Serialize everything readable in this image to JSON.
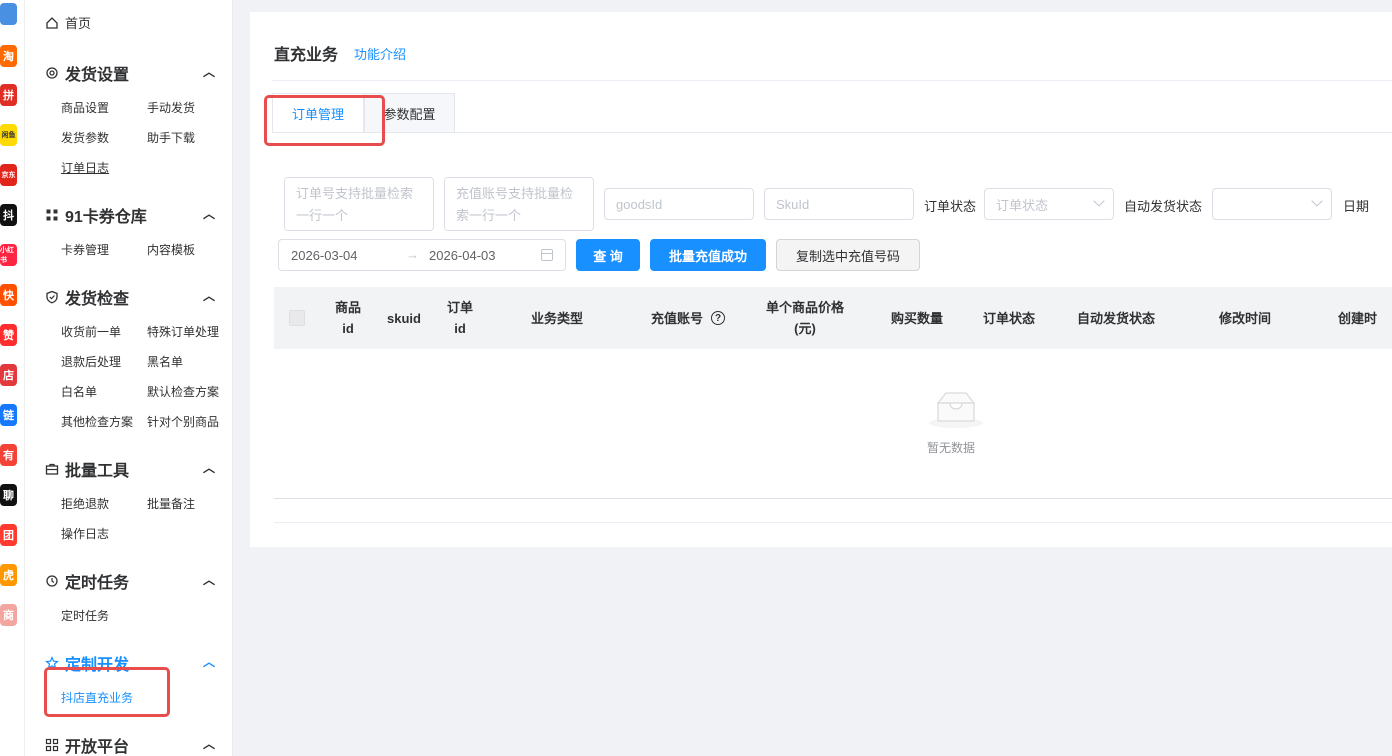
{
  "platforms": [
    {
      "name": "grid-app",
      "label": "",
      "color": "#4a90e2"
    },
    {
      "name": "taobao",
      "label": "淘",
      "color": "#ff6a00"
    },
    {
      "name": "pinduoduo",
      "label": "拼",
      "color": "#e02e24"
    },
    {
      "name": "xianyu",
      "label": "闲鱼",
      "color": "#ffda00"
    },
    {
      "name": "jingdong",
      "label": "京东",
      "color": "#e1251b"
    },
    {
      "name": "douyin",
      "label": "抖",
      "color": "#111111"
    },
    {
      "name": "xiaohongshu",
      "label": "小红书",
      "color": "#ff2442"
    },
    {
      "name": "kuaishou",
      "label": "快",
      "color": "#ff5000"
    },
    {
      "name": "weidian",
      "label": "赞",
      "color": "#ff2d2d"
    },
    {
      "name": "dianpu",
      "label": "店",
      "color": "#e4393c"
    },
    {
      "name": "link-app",
      "label": "链",
      "color": "#1677ff"
    },
    {
      "name": "youzan",
      "label": "有",
      "color": "#f44336"
    },
    {
      "name": "douyin-chat",
      "label": "聊",
      "color": "#111111"
    },
    {
      "name": "kuaituan",
      "label": "团",
      "color": "#ff3b30"
    },
    {
      "name": "tiger-app",
      "label": "虎",
      "color": "#ff9800"
    },
    {
      "name": "shop-app",
      "label": "商",
      "color": "#f3a6a0"
    }
  ],
  "sidebar": {
    "home": "首页",
    "groups": [
      {
        "title": "发货设置",
        "items": [
          "商品设置",
          "手动发货",
          "发货参数",
          "助手下载",
          "订单日志"
        ]
      },
      {
        "title": "91卡券仓库",
        "items": [
          "卡券管理",
          "内容模板"
        ]
      },
      {
        "title": "发货检查",
        "items": [
          "收货前一单",
          "特殊订单处理",
          "退款后处理",
          "黑名单",
          "白名单",
          "默认检查方案",
          "其他检查方案",
          "针对个别商品"
        ]
      },
      {
        "title": "批量工具",
        "items": [
          "拒绝退款",
          "批量备注",
          "操作日志"
        ]
      },
      {
        "title": "定时任务",
        "items": [
          "定时任务"
        ]
      },
      {
        "title": "定制开发",
        "items": [
          "抖店直充业务"
        ]
      },
      {
        "title": "开放平台",
        "items": []
      }
    ]
  },
  "header": {
    "title": "直充业务",
    "feature_link": "功能介绍"
  },
  "tabs": [
    {
      "label": "订单管理",
      "active": true
    },
    {
      "label": "参数配置",
      "active": false
    }
  ],
  "filters": {
    "order_no_placeholder": "订单号支持批量检索一行一个",
    "account_placeholder": "充值账号支持批量检索一行一个",
    "goods_id_placeholder": "goodsId",
    "sku_id_placeholder": "SkuId",
    "order_status_label": "订单状态",
    "order_status_placeholder": "订单状态",
    "auto_ship_label": "自动发货状态",
    "auto_ship_value": "",
    "date_label": "日期",
    "date_start": "2026-03-04",
    "date_sep": "→",
    "date_end": "2026-04-03"
  },
  "buttons": {
    "query": "查 询",
    "batch_success": "批量充值成功",
    "copy_accounts": "复制选中充值号码"
  },
  "table": {
    "columns": [
      "商品\nid",
      "skuid",
      "订单\nid",
      "业务类型",
      "充值账号",
      "单个商品价格\n(元)",
      "购买数量",
      "订单状态",
      "自动发货状态",
      "修改时间",
      "创建时"
    ],
    "help_symbol": "?",
    "empty_text": "暂无数据"
  },
  "colors": {
    "accent": "#1890ff",
    "highlight": "#e84c4c"
  }
}
